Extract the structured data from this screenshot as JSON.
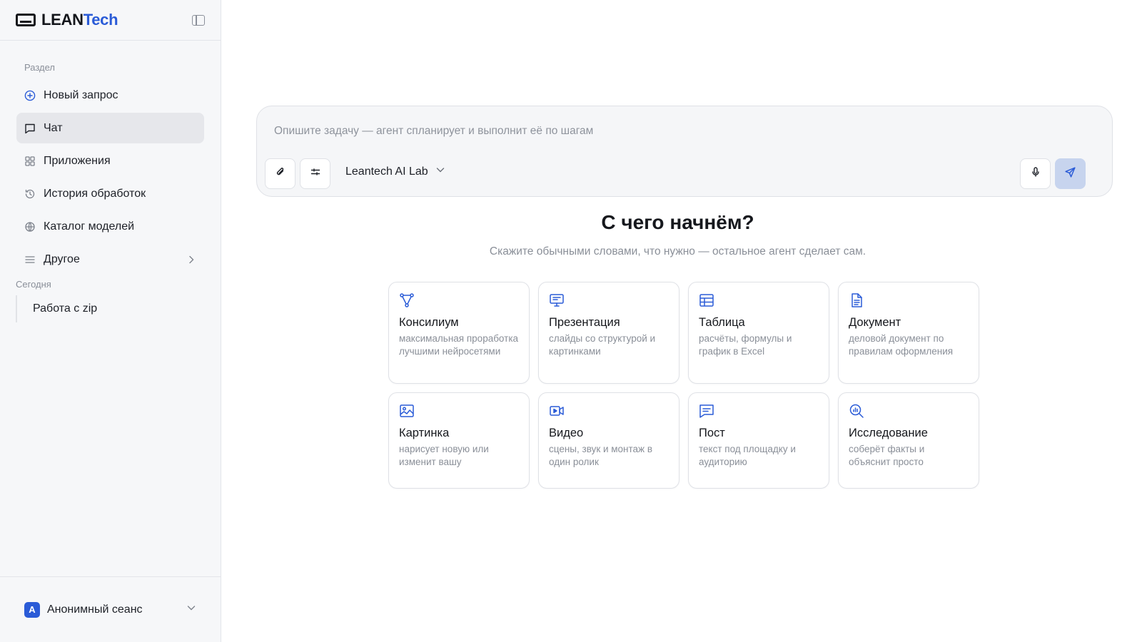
{
  "brand": {
    "part1": "LEAN",
    "part2": "Tech"
  },
  "sidebar": {
    "section_label": "Раздел",
    "items": [
      {
        "label": "Новый запрос",
        "icon": "plus-circle-icon"
      },
      {
        "label": "Чат",
        "icon": "chat-icon",
        "active": true
      },
      {
        "label": "Приложения",
        "icon": "apps-grid-icon"
      },
      {
        "label": "История обработок",
        "icon": "history-icon"
      },
      {
        "label": "Каталог моделей",
        "icon": "globe-icon"
      },
      {
        "label": "Другое",
        "icon": "menu-icon",
        "has_submenu": true
      }
    ],
    "history_label": "Сегодня",
    "history": [
      {
        "label": "Работа с zip"
      }
    ],
    "user": {
      "avatar_letter": "A",
      "name": "Анонимный сеанс"
    }
  },
  "composer": {
    "placeholder": "Опишите задачу — агент спланирует и выполнит её по шагам",
    "model": "Leantech AI Lab"
  },
  "hero": {
    "title": "С чего начнём?",
    "subtitle": "Скажите обычными словами, что нужно — остальное агент сделает сам."
  },
  "cards": [
    {
      "title": "Консилиум",
      "desc": "максимальная проработка лучшими нейросетями",
      "icon": "network-icon"
    },
    {
      "title": "Презентация",
      "desc": "слайды со структурой и картинками",
      "icon": "presentation-icon"
    },
    {
      "title": "Таблица",
      "desc": "расчёты, формулы и график в Excel",
      "icon": "table-icon"
    },
    {
      "title": "Документ",
      "desc": "деловой документ по правилам оформления",
      "icon": "document-icon"
    },
    {
      "title": "Картинка",
      "desc": "нарисует новую или изменит вашу",
      "icon": "image-icon"
    },
    {
      "title": "Видео",
      "desc": "сцены, звук и монтаж в один ролик",
      "icon": "video-icon"
    },
    {
      "title": "Пост",
      "desc": "текст под площадку и аудиторию",
      "icon": "post-icon"
    },
    {
      "title": "Исследование",
      "desc": "соберёт факты и объяснит просто",
      "icon": "research-icon"
    }
  ],
  "colors": {
    "accent": "#2a5bd7",
    "sidebar_bg": "#f6f7f9",
    "active_item": "#e6e7eb",
    "send_button": "#c7d4ee"
  }
}
